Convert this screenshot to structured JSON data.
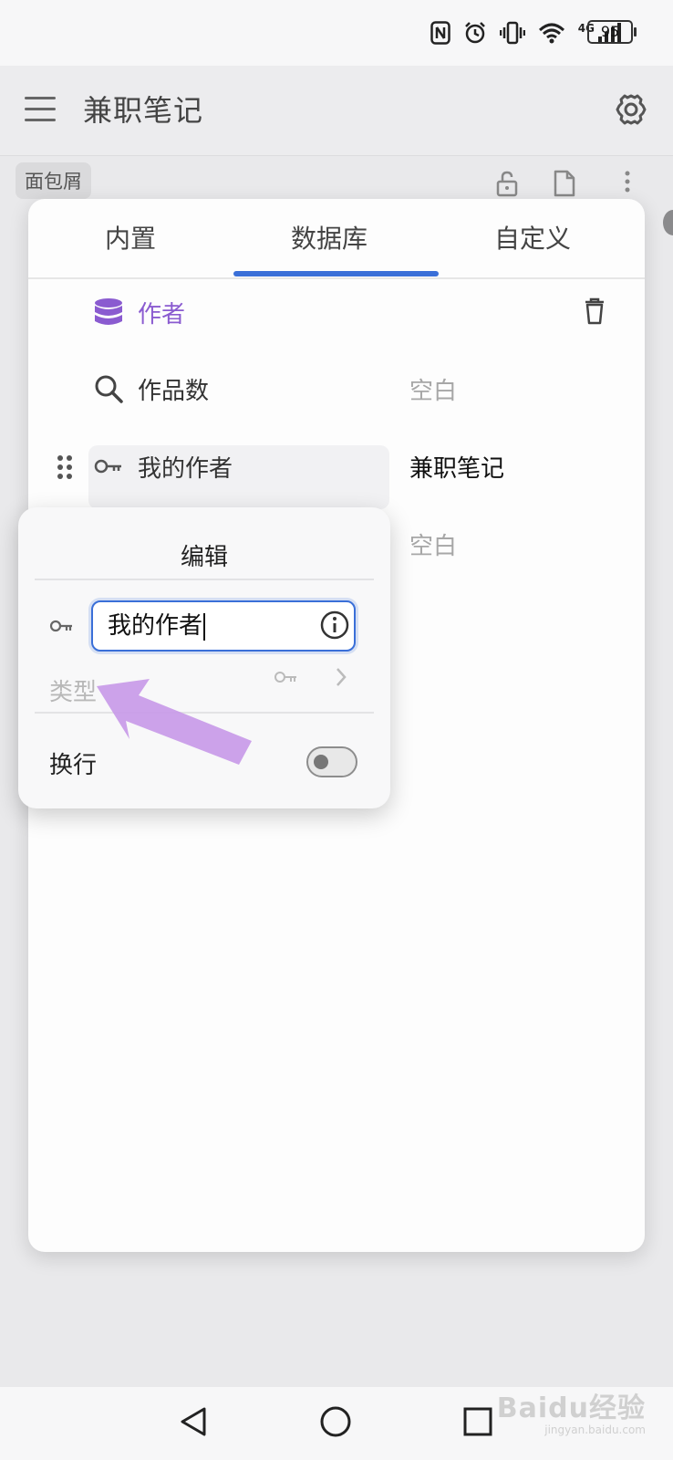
{
  "status_bar": {
    "battery": "95",
    "network": "4G",
    "icons": [
      "nfc-icon",
      "alarm-icon",
      "vibrate-icon",
      "wifi-icon",
      "signal-icon",
      "battery-icon"
    ]
  },
  "app_bar": {
    "title": "兼职笔记",
    "menu_icon": "menu-icon",
    "settings_icon": "gear-icon"
  },
  "breadcrumb": {
    "label": "面包屑"
  },
  "top_actions": [
    "unlock-icon",
    "document-icon",
    "more-vertical-icon"
  ],
  "tabs": [
    {
      "label": "内置",
      "selected": false
    },
    {
      "label": "数据库",
      "selected": true
    },
    {
      "label": "自定义",
      "selected": false
    }
  ],
  "database": {
    "title": "作者",
    "color": "#8a5bd0",
    "rows": [
      {
        "label": "作品数",
        "value": "空白",
        "icon": "search-icon"
      },
      {
        "label": "我的作者",
        "value": "兼职笔记",
        "icon": "key-icon"
      },
      {
        "value": "空白"
      }
    ]
  },
  "edit_popup": {
    "title": "编辑",
    "name_value": "我的作者",
    "type_label": "类型",
    "wrap_label": "换行",
    "wrap_enabled": false
  },
  "accent_color": "#3a6fd8",
  "arrow_color": "#c89ae8",
  "watermark": {
    "main": "Baidu经验",
    "sub": "jingyan.baidu.com"
  }
}
